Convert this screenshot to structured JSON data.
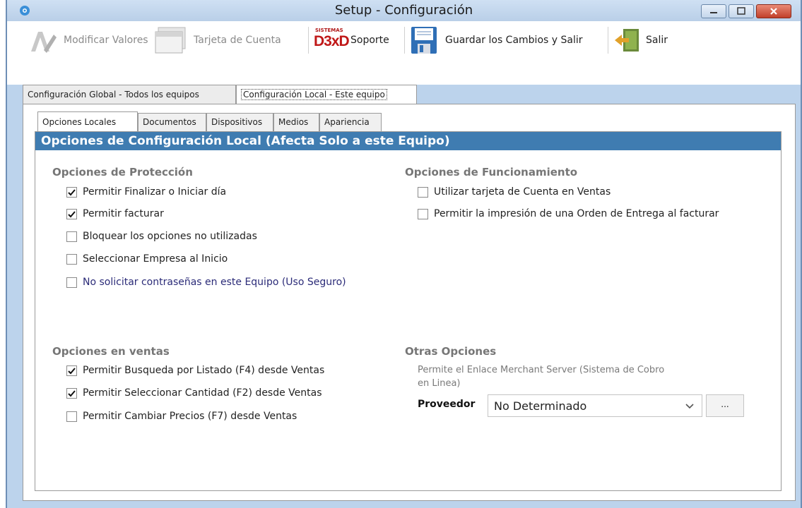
{
  "window": {
    "title": "Setup - Configuración",
    "icons": {
      "app": "gear-icon",
      "minimize": "minimize-icon",
      "maximize": "maximize-icon",
      "close": "close-icon"
    }
  },
  "toolbar": {
    "modify_values": "Modificar Valores",
    "account_card": "Tarjeta de Cuenta",
    "support_logo_small": "SISTEMAS",
    "support_logo_big": "D3xD",
    "support": "Soporte",
    "save_exit": "Guardar los Cambios  y Salir",
    "exit": "Salir"
  },
  "outer_tabs": [
    "Configuración Global - Todos los equipos",
    "Configuración Local - Este equipo"
  ],
  "inner_tabs": [
    "Opciones Locales",
    "Documentos",
    "Dispositivos",
    "Medios",
    "Apariencia"
  ],
  "panel": {
    "header": "Opciones de Configuración Local (Afecta Solo a este Equipo)",
    "protection": {
      "title": "Opciones de Protección",
      "items": [
        {
          "label": "Permitir Finalizar o Iniciar día",
          "checked": true
        },
        {
          "label": "Permitir facturar",
          "checked": true
        },
        {
          "label": "Bloquear los opciones no utilizadas",
          "checked": false
        },
        {
          "label": "Seleccionar Empresa al Inicio",
          "checked": false
        },
        {
          "label": "No solicitar contraseñas en este Equipo (Uso Seguro)",
          "checked": false
        }
      ]
    },
    "operation": {
      "title": "Opciones de Funcionamiento",
      "items": [
        {
          "label": "Utilizar tarjeta de Cuenta en Ventas",
          "checked": false
        },
        {
          "label": "Permitir la impresión de una Orden de Entrega al facturar",
          "checked": false
        }
      ]
    },
    "sales": {
      "title": "Opciones en ventas",
      "items": [
        {
          "label": "Permitir Busqueda por Listado (F4) desde Ventas",
          "checked": true
        },
        {
          "label": "Permitir Seleccionar Cantidad (F2) desde Ventas",
          "checked": true
        },
        {
          "label": "Permitir Cambiar Precios (F7) desde Ventas",
          "checked": false
        }
      ]
    },
    "other": {
      "title": "Otras Opciones",
      "description": "Permite el Enlace Merchant Server (Sistema de Cobro en Linea)",
      "provider_label": "Proveedor",
      "provider_value": "No Determinado",
      "browse_button": "..."
    }
  },
  "colors": {
    "header_bar": "#3f7cb1",
    "section_title": "#767676",
    "window_frame": "#bcd3ec"
  }
}
